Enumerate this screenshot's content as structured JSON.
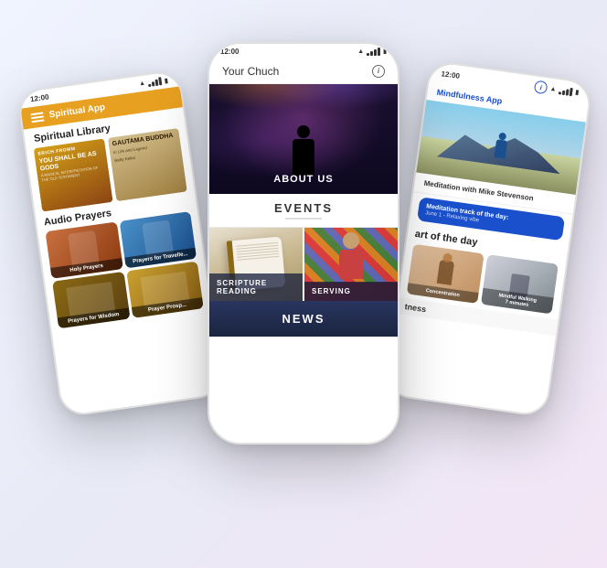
{
  "left_phone": {
    "status_time": "12:00",
    "app_name": "Spiritual App",
    "section_library": "Spiritual Library",
    "book1_author": "ERICH FROMM",
    "book1_title": "YOU SHALL BE AS GODS",
    "book1_sub": "A RADICAL INTERPRETATION OF THE OLD TESTAMENT",
    "book2_title": "Gautama Buddha",
    "book2_subtitle": "in Life and Legend",
    "book2_author": "Betty Kelen",
    "section_audio": "Audio Prayers",
    "prayer1": "Holy Prayers",
    "prayer2": "Prayers for Travelle...",
    "prayer3": "Prayers for Wisdom",
    "prayer4": "Prayer Prosp..."
  },
  "center_phone": {
    "status_time": "12:00",
    "church_name": "Your Chuch",
    "about_us": "About us",
    "events": "Events",
    "scripture": "Scripture reading",
    "serving": "Serving",
    "news": "News"
  },
  "right_phone": {
    "status_time": "12:00",
    "app_name": "Mindfulness App",
    "meditation_title": "Meditation with Mike Stevenson",
    "track_label": "Meditation track of the day:",
    "track_subtitle": "June 1 - Relaxing vibe",
    "art_of_day": "art of the day",
    "art1_label": "Concentration",
    "art2_label": "Mindful Walking",
    "art2_sub": "7 minutes",
    "fitness": "tness"
  },
  "icons": {
    "info": "i",
    "hamburger": "☰",
    "wifi": "▲",
    "battery": "▮"
  }
}
